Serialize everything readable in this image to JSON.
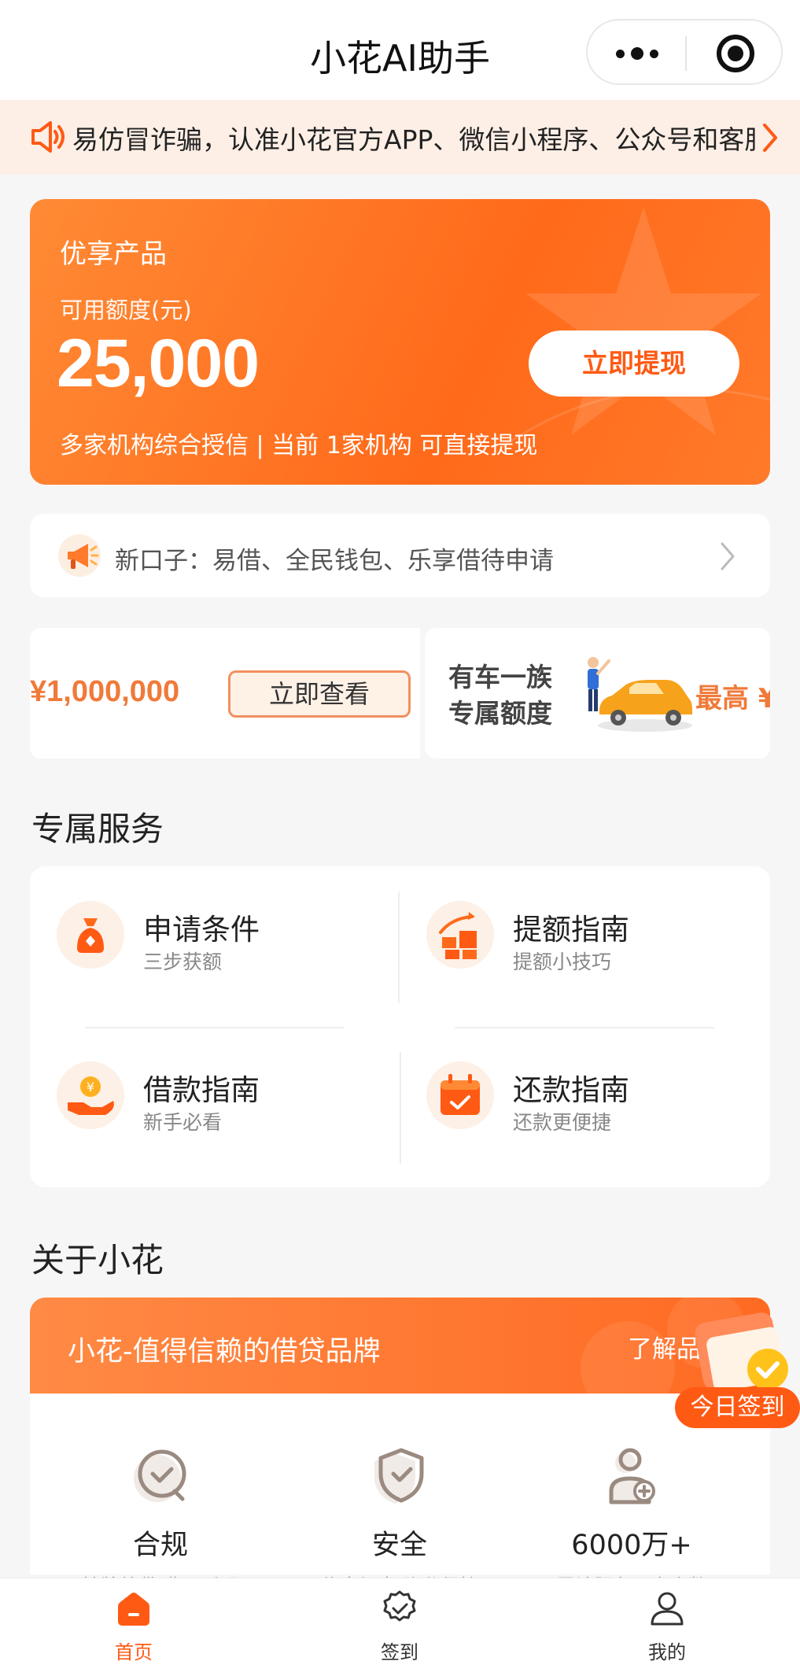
{
  "header": {
    "title": "小花AI助手"
  },
  "notice": {
    "text": "易仿冒诈骗，认准小花官方APP、微信小程序、公众号和客服"
  },
  "credit": {
    "product_label": "优享产品",
    "amount_label": "可用额度(元)",
    "amount": "25,000",
    "description": "多家机构综合授信 | 当前 1家机构 可直接提现",
    "withdraw_button": "立即提现"
  },
  "new_loans": {
    "text": "新口子：易借、全民钱包、乐享借待申请"
  },
  "banners": {
    "amount": "¥1,000,000",
    "view_button": "立即查看",
    "car_line1": "有车一族",
    "car_line2": "专属额度",
    "car_highest": "最高 ¥"
  },
  "services": {
    "title": "专属服务",
    "items": [
      {
        "name": "申请条件",
        "sub": "三步获额"
      },
      {
        "name": "提额指南",
        "sub": "提额小技巧"
      },
      {
        "name": "借款指南",
        "sub": "新手必看"
      },
      {
        "name": "还款指南",
        "sub": "还款更便捷"
      }
    ]
  },
  "about": {
    "title": "关于小花",
    "banner_text": "小花-值得信赖的借贷品牌",
    "more_link": "了解品",
    "features": [
      {
        "label": "合规",
        "sub": "持牌放贷 费用透明"
      },
      {
        "label": "安全",
        "sub": "信息加密 隐私保护"
      },
      {
        "label": "6000万+",
        "sub": "累计服务用户人数"
      }
    ]
  },
  "signin_badge": "今日签到",
  "tabbar": {
    "items": [
      {
        "label": "首页",
        "icon": "home-icon"
      },
      {
        "label": "签到",
        "icon": "checkin-icon"
      },
      {
        "label": "我的",
        "icon": "user-icon"
      }
    ]
  },
  "colors": {
    "brand": "#ff6a1a",
    "accent": "#ff5a14",
    "notice_bg": "#fdefe6"
  }
}
